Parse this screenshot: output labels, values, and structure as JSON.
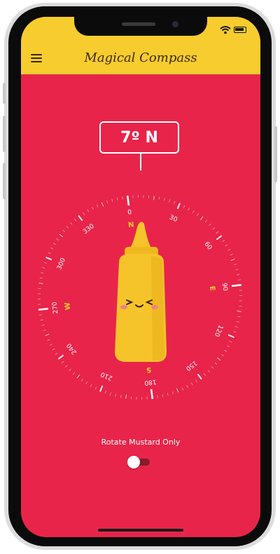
{
  "app": {
    "title": "Magical Compass"
  },
  "heading": {
    "degrees": 7,
    "label": "7º N"
  },
  "compass": {
    "cardinals": [
      {
        "text": "N",
        "angle": 0
      },
      {
        "text": "E",
        "angle": 90
      },
      {
        "text": "S",
        "angle": 180
      },
      {
        "text": "W",
        "angle": 270
      }
    ],
    "degree_labels": [
      "0",
      "30",
      "60",
      "90",
      "120",
      "150",
      "180",
      "210",
      "240",
      "270",
      "300",
      "330"
    ],
    "cardinal_color": "#f7cc2f"
  },
  "toggle": {
    "label": "Rotate Mustard Only",
    "on": false
  },
  "colors": {
    "background": "#e8244a",
    "app_bar": "#f7cc2f",
    "mustard": "#f5c42a"
  }
}
